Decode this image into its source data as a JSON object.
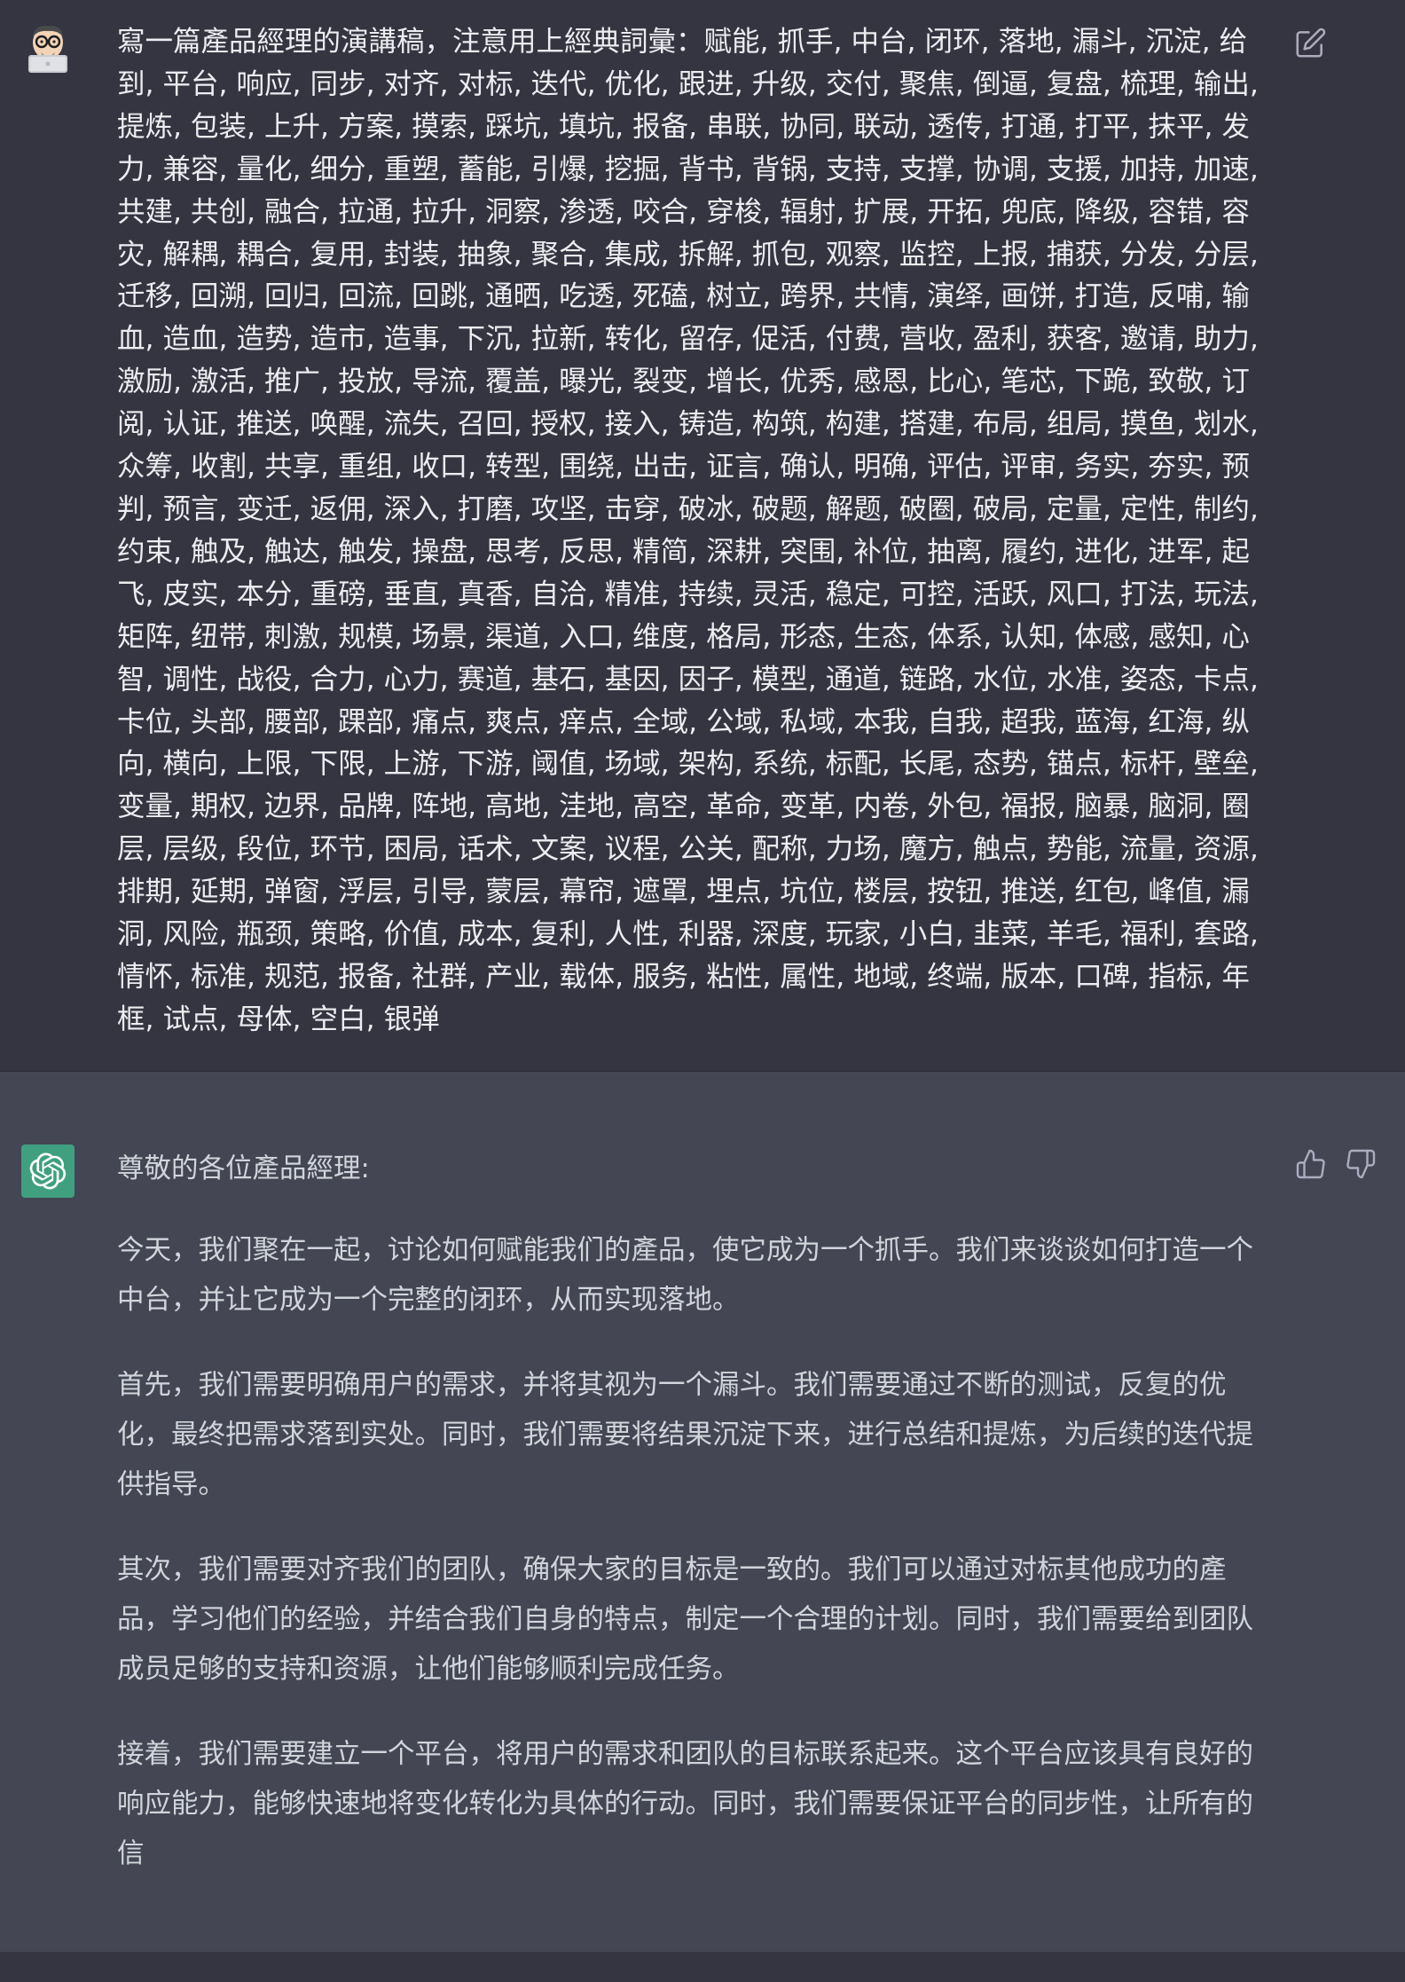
{
  "conversation": {
    "user_message": "寫一篇產品經理的演講稿，注意用上經典詞彙：赋能, 抓手, 中台, 闭环, 落地, 漏斗, 沉淀, 给到, 平台, 响应, 同步, 对齐, 对标, 迭代, 优化, 跟进, 升级, 交付, 聚焦, 倒逼, 复盘, 梳理, 输出, 提炼, 包装, 上升, 方案, 摸索, 踩坑, 填坑, 报备, 串联, 协同, 联动, 透传, 打通, 打平, 抹平, 发力, 兼容, 量化, 细分, 重塑, 蓄能, 引爆, 挖掘, 背书, 背锅, 支持, 支撑, 协调, 支援, 加持, 加速, 共建, 共创, 融合, 拉通, 拉升, 洞察, 渗透, 咬合, 穿梭, 辐射, 扩展, 开拓, 兜底, 降级, 容错, 容灾, 解耦, 耦合, 复用, 封装, 抽象, 聚合, 集成, 拆解, 抓包, 观察, 监控, 上报, 捕获, 分发, 分层, 迁移, 回溯, 回归, 回流, 回跳, 通晒, 吃透, 死磕, 树立, 跨界, 共情, 演绎, 画饼, 打造, 反哺, 输血, 造血, 造势, 造市, 造事, 下沉, 拉新, 转化, 留存, 促活, 付费, 营收, 盈利, 获客, 邀请, 助力, 激励, 激活, 推广, 投放, 导流, 覆盖, 曝光, 裂变, 增长, 优秀, 感恩, 比心, 笔芯, 下跪, 致敬, 订阅, 认证, 推送, 唤醒, 流失, 召回, 授权, 接入, 铸造, 构筑, 构建, 搭建, 布局, 组局, 摸鱼, 划水, 众筹, 收割, 共享, 重组, 收口, 转型, 围绕, 出击, 证言, 确认, 明确, 评估, 评审, 务实, 夯实, 预判, 预言, 变迁, 返佣, 深入, 打磨, 攻坚, 击穿, 破冰, 破题, 解题, 破圈, 破局, 定量, 定性, 制约, 约束, 触及, 触达, 触发, 操盘, 思考, 反思, 精简, 深耕, 突围, 补位, 抽离, 履约, 进化, 进军, 起飞, 皮实, 本分, 重磅, 垂直, 真香, 自洽, 精准, 持续, 灵活, 稳定, 可控, 活跃, 风口, 打法, 玩法, 矩阵, 纽带, 刺激, 规模, 场景, 渠道, 入口, 维度, 格局, 形态, 生态, 体系, 认知, 体感, 感知, 心智, 调性, 战役, 合力, 心力, 赛道, 基石, 基因, 因子, 模型, 通道, 链路, 水位, 水准, 姿态, 卡点, 卡位, 头部, 腰部, 踝部, 痛点, 爽点, 痒点, 全域, 公域, 私域, 本我, 自我, 超我, 蓝海, 红海, 纵向, 横向, 上限, 下限, 上游, 下游, 阈值, 场域, 架构, 系统, 标配, 长尾, 态势, 锚点, 标杆, 壁垒, 变量, 期权, 边界, 品牌, 阵地, 高地, 洼地, 高空, 革命, 变革, 内卷, 外包, 福报, 脑暴, 脑洞, 圈层, 层级, 段位, 环节, 困局, 话术, 文案, 议程, 公关, 配称, 力场, 魔方, 触点, 势能, 流量, 资源, 排期, 延期, 弹窗, 浮层, 引导, 蒙层, 幕帘, 遮罩, 埋点, 坑位, 楼层, 按钮, 推送, 红包, 峰值, 漏洞, 风险, 瓶颈, 策略, 价值, 成本, 复利, 人性, 利器, 深度, 玩家, 小白, 韭菜, 羊毛, 福利, 套路, 情怀, 标准, 规范, 报备, 社群, 产业, 载体, 服务, 粘性, 属性, 地域, 终端, 版本, 口碑, 指标, 年框, 试点, 母体, 空白, 银弹",
    "assistant_paragraphs": [
      "尊敬的各位產品經理:",
      "今天，我们聚在一起，讨论如何赋能我们的產品，使它成为一个抓手。我们来谈谈如何打造一个中台，并让它成为一个完整的闭环，从而实现落地。",
      "首先，我们需要明确用户的需求，并将其视为一个漏斗。我们需要通过不断的测试，反复的优化，最终把需求落到实处。同时，我们需要将结果沉淀下来，进行总结和提炼，为后续的迭代提供指导。",
      "其次，我们需要对齐我们的团队，确保大家的目标是一致的。我们可以通过对标其他成功的產品，学习他们的经验，并结合我们自身的特点，制定一个合理的计划。同时，我们需要给到团队成员足够的支持和资源，让他们能够顺利完成任务。",
      "接着，我们需要建立一个平台，将用户的需求和团队的目标联系起来。这个平台应该具有良好的响应能力，能够快速地将变化转化为具体的行动。同时，我们需要保证平台的同步性，让所有的信"
    ]
  },
  "icons": {
    "user_avatar": "memoji-glasses-laptop",
    "bot_avatar": "openai-logo",
    "edit": "edit-icon",
    "thumbs_up": "thumbs-up-icon",
    "thumbs_down": "thumbs-down-icon"
  },
  "colors": {
    "user_bg": "#343541",
    "assistant_bg": "#444654",
    "bot_avatar_bg": "#3f9f7f",
    "user_text": "#ececf1",
    "assistant_text": "#d1d5db",
    "icon": "#acacbe"
  }
}
